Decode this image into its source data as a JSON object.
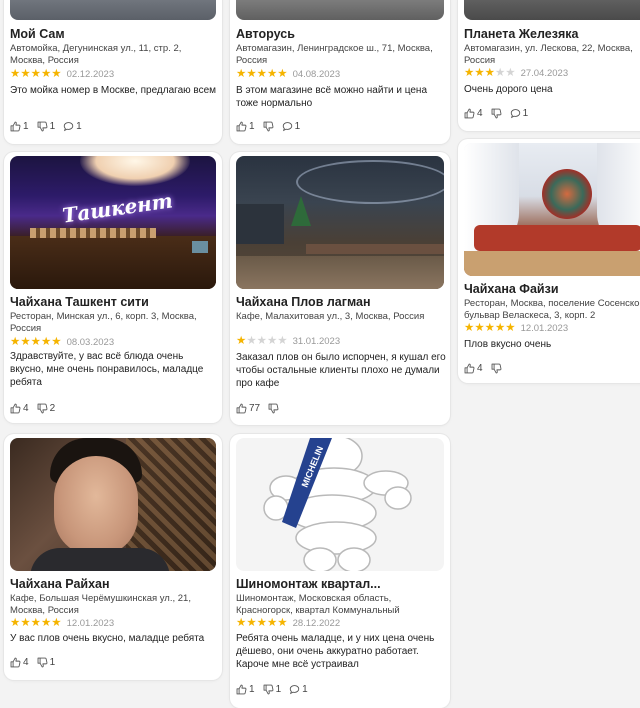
{
  "cards": [
    {
      "title": "Мой Сам",
      "address": "Автомойка, Дегунинская ул., 11, стр. 2, Москва, Россия",
      "rating": 5,
      "date": "02.12.2023",
      "text": "Это мойка номер в Москве, предлагаю всем",
      "likes": "1",
      "dislikes": "1",
      "comments": "1"
    },
    {
      "title": "Авторусь",
      "address": "Автомагазин, Ленинградское ш., 71, Москва, Россия",
      "rating": 5,
      "date": "04.08.2023",
      "text": "В этом магазине всё можно найти и цена тоже нормально",
      "likes": "1",
      "dislikes": "",
      "comments": "1"
    },
    {
      "title": "Планета Железяка",
      "address": "Автомагазин, ул. Лескова, 22, Москва, Россия",
      "rating": 3,
      "date": "27.04.2023",
      "text": "Очень дорого цена",
      "likes": "4",
      "dislikes": "",
      "comments": "1"
    },
    {
      "title": "Чайхана Ташкент сити",
      "address": "Ресторан, Минская ул., 6, корп. 3, Москва, Россия",
      "rating": 5,
      "date": "08.03.2023",
      "text": "Здравствуйте,  у вас всё блюда очень вкусно, мне очень понравилось,  маладце ребята",
      "likes": "4",
      "dislikes": "2",
      "comments": "",
      "photo_sign": "Ташкент"
    },
    {
      "title": "Чайхана Плов лагман",
      "address": "Кафе, Малахитовая ул., 3, Москва, Россия",
      "rating": 1,
      "date": "31.01.2023",
      "text": "Заказал плов он было испорчен, я кушал его чтобы остальные клиенты плохо не думали про кафе",
      "likes": "77",
      "dislikes": "",
      "comments": ""
    },
    {
      "title": "Чайхана Файзи",
      "address": "Ресторан, Москва, поселение Сосенское, бульвар Веласкеса, 3, корп. 2",
      "rating": 5,
      "date": "12.01.2023",
      "text": "Плов вкусно очень",
      "likes": "4",
      "dislikes": "",
      "comments": ""
    },
    {
      "title": "Чайхана Райхан",
      "address": "Кафе, Большая Черёмушкинская ул., 21, Москва, Россия",
      "rating": 5,
      "date": "12.01.2023",
      "text": "У вас плов очень вкусно, маладце ребята",
      "likes": "4",
      "dislikes": "1",
      "comments": ""
    },
    {
      "title": "Шиномонтаж квартал...",
      "address": "Шиномонтаж, Московская область, Красногорск, квартал Коммунальный",
      "rating": 5,
      "date": "28.12.2022",
      "text": "Ребята очень маладце, и у них цена очень дёшево,  они очень аккуратно работает. Кароче мне всё устраивал",
      "likes": "1",
      "dislikes": "1",
      "comments": "1",
      "photo_sign": "MICHELIN"
    }
  ],
  "colors": {
    "star_on": "#f5b400",
    "star_off": "#d4d4d4",
    "date": "#999999"
  }
}
